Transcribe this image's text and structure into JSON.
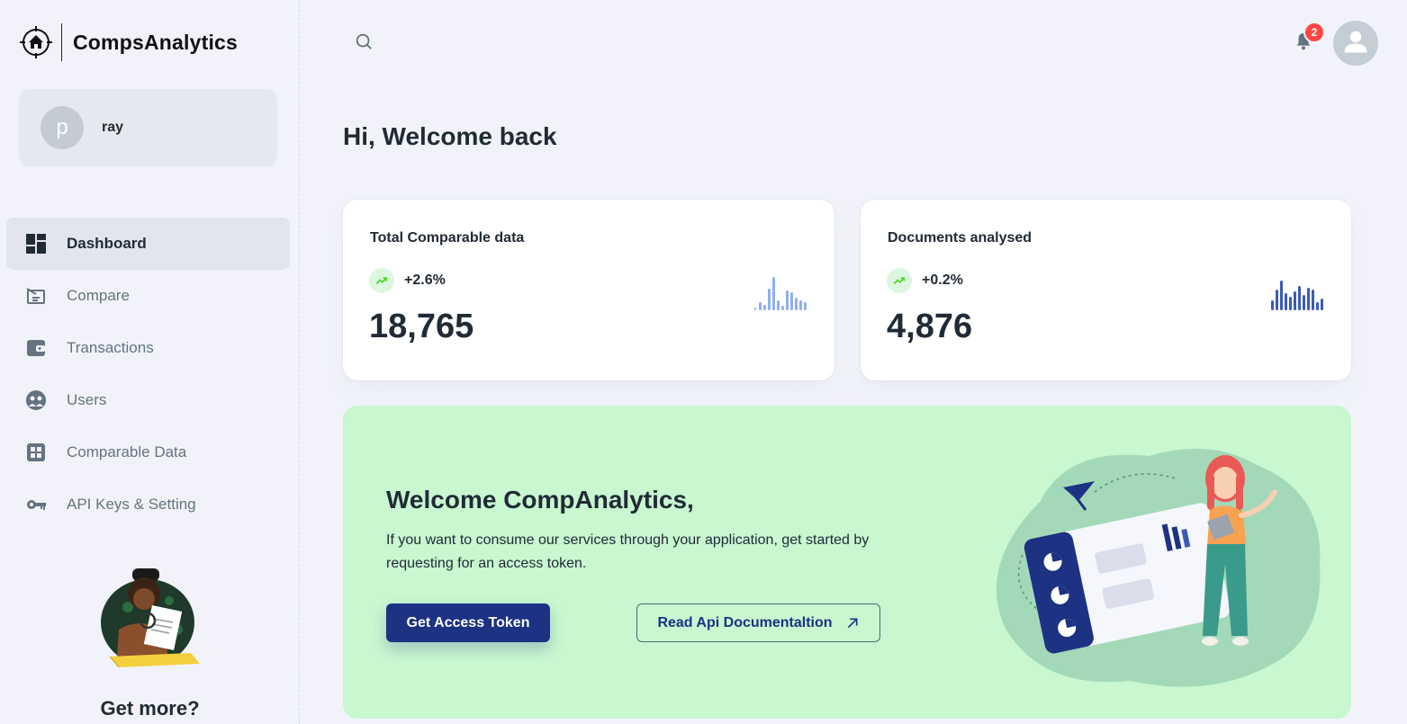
{
  "brand": {
    "name": "CompsAnalytics"
  },
  "account": {
    "initial": "p",
    "name": "ray"
  },
  "nav": {
    "items": [
      {
        "label": "Dashboard",
        "icon": "dashboard-icon",
        "active": true
      },
      {
        "label": "Compare",
        "icon": "compare-icon"
      },
      {
        "label": "Transactions",
        "icon": "wallet-icon"
      },
      {
        "label": "Users",
        "icon": "users-icon"
      },
      {
        "label": "Comparable Data",
        "icon": "grid-icon"
      },
      {
        "label": "API Keys & Setting",
        "icon": "key-icon"
      }
    ]
  },
  "promo": {
    "title": "Get more?"
  },
  "header": {
    "notification_count": "2"
  },
  "greeting": "Hi, Welcome back",
  "stats": [
    {
      "title": "Total Comparable data",
      "trend": "+2.6%",
      "value": "18,765",
      "spark_color": "#8fb0f0"
    },
    {
      "title": "Documents analysed",
      "trend": "+0.2%",
      "value": "4,876",
      "spark_color": "#3b5bb3"
    }
  ],
  "banner": {
    "title": "Welcome CompAnalytics,",
    "description": "If you want to consume our services through your application, get started by requesting for an access token.",
    "primary_button": "Get Access Token",
    "secondary_button": "Read Api Documentaltion"
  },
  "colors": {
    "primary": "#1d3282",
    "banner_bg": "#c8f7d0",
    "badge": "#ff4842",
    "trend_up": "#54d62c"
  }
}
